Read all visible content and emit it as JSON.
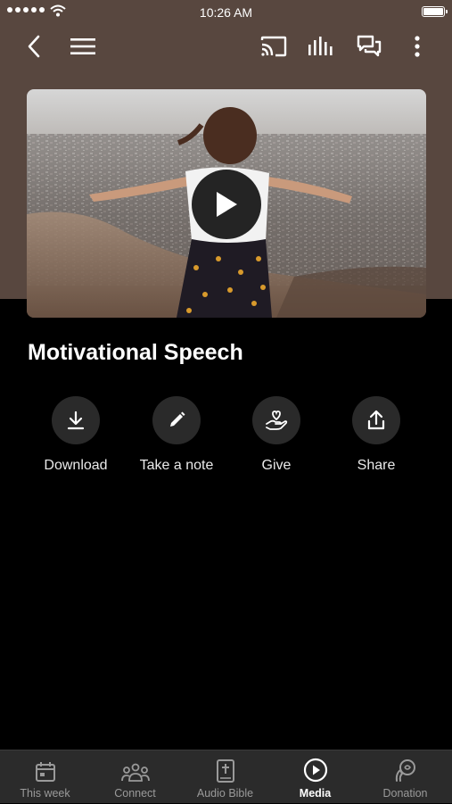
{
  "status_bar": {
    "time": "10:26 AM",
    "signal_icon": "signal-dots-icon",
    "wifi_icon": "wifi-icon",
    "battery_icon": "battery-icon",
    "battery_level": 1.0
  },
  "toolbar": {
    "back_icon": "back-chevron-icon",
    "menu_icon": "hamburger-menu-icon",
    "cast_icon": "cast-icon",
    "audio_icon": "audio-bars-icon",
    "chat_icon": "chat-bubbles-icon",
    "more_icon": "more-vertical-icon"
  },
  "video": {
    "play_icon": "play-icon"
  },
  "media": {
    "title": "Motivational Speech"
  },
  "actions": [
    {
      "label": "Download",
      "icon": "download-icon"
    },
    {
      "label": "Take a note",
      "icon": "pencil-icon"
    },
    {
      "label": "Give",
      "icon": "hand-heart-icon"
    },
    {
      "label": "Share",
      "icon": "share-icon"
    }
  ],
  "bottom_nav": {
    "active_index": 3,
    "items": [
      {
        "label": "This week",
        "icon": "calendar-icon"
      },
      {
        "label": "Connect",
        "icon": "people-icon"
      },
      {
        "label": "Audio Bible",
        "icon": "bible-icon"
      },
      {
        "label": "Media",
        "icon": "play-circle-icon"
      },
      {
        "label": "Donation",
        "icon": "donation-icon"
      }
    ]
  },
  "colors": {
    "header_bg": "#58473f",
    "page_bg": "#000000",
    "nav_bg": "#2b2b2b",
    "action_circle": "#2a2a2a"
  }
}
